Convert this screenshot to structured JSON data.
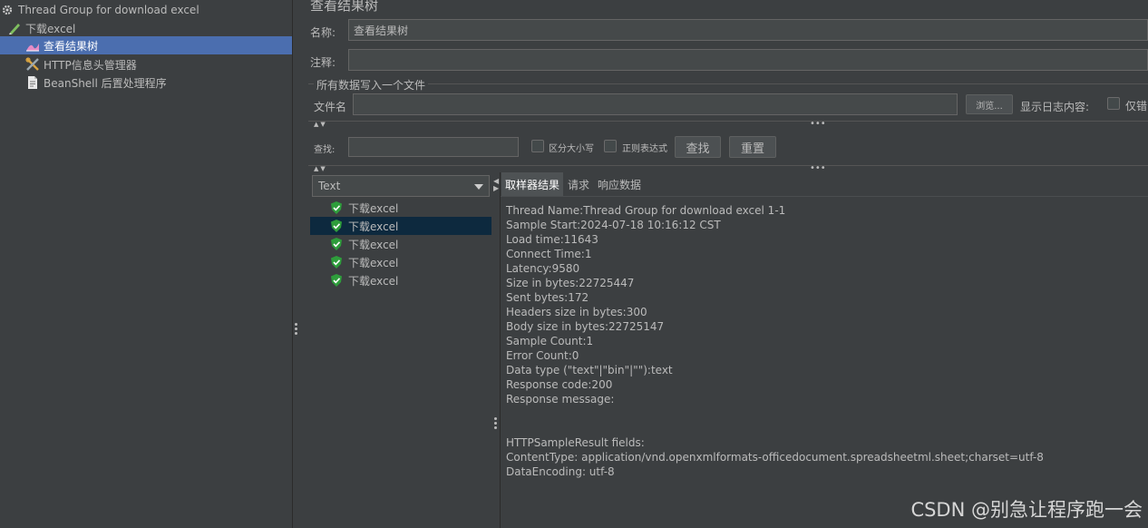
{
  "tree": {
    "items": [
      {
        "label": "Thread Group for download excel",
        "icon": "gear-icon"
      },
      {
        "label": "下载excel",
        "icon": "pencil-icon"
      },
      {
        "label": "查看结果树",
        "icon": "chart-icon"
      },
      {
        "label": "HTTP信息头管理器",
        "icon": "tools-icon"
      },
      {
        "label": "BeanShell 后置处理程序",
        "icon": "document-icon"
      }
    ]
  },
  "header": {
    "title": "查看结果树",
    "name_label": "名称:",
    "name_value": "查看结果树",
    "comment_label": "注释:",
    "comment_value": ""
  },
  "file_section": {
    "legend": "所有数据写入一个文件",
    "filename_label": "文件名",
    "filename_value": "",
    "browse_label": "浏览...",
    "log_content_label": "显示日志内容:",
    "errors_only_label": "仅错"
  },
  "search": {
    "label": "查找:",
    "value": "",
    "case_label": "区分大小写",
    "regex_label": "正则表达式",
    "find_label": "查找",
    "reset_label": "重置"
  },
  "renderer": {
    "selected": "Text"
  },
  "samples": [
    {
      "label": "下载excel",
      "status": "success"
    },
    {
      "label": "下载excel",
      "status": "success"
    },
    {
      "label": "下载excel",
      "status": "success"
    },
    {
      "label": "下载excel",
      "status": "success"
    },
    {
      "label": "下载excel",
      "status": "success"
    }
  ],
  "tabs": [
    {
      "label": "取样器结果"
    },
    {
      "label": "请求"
    },
    {
      "label": "响应数据"
    }
  ],
  "result_text": "Thread Name:Thread Group for download excel 1-1\nSample Start:2024-07-18 10:16:12 CST\nLoad time:11643\nConnect Time:1\nLatency:9580\nSize in bytes:22725447\nSent bytes:172\nHeaders size in bytes:300\nBody size in bytes:22725147\nSample Count:1\nError Count:0\nData type (\"text\"|\"bin\"|\"\"):text\nResponse code:200\nResponse message:\n\n\nHTTPSampleResult fields:\nContentType: application/vnd.openxmlformats-officedocument.spreadsheetml.sheet;charset=utf-8\nDataEncoding: utf-8",
  "watermark": "CSDN @别急让程序跑一会",
  "colors": {
    "selection": "#4b6eaf",
    "success": "#2e9d3b",
    "background": "#3c3f41"
  }
}
